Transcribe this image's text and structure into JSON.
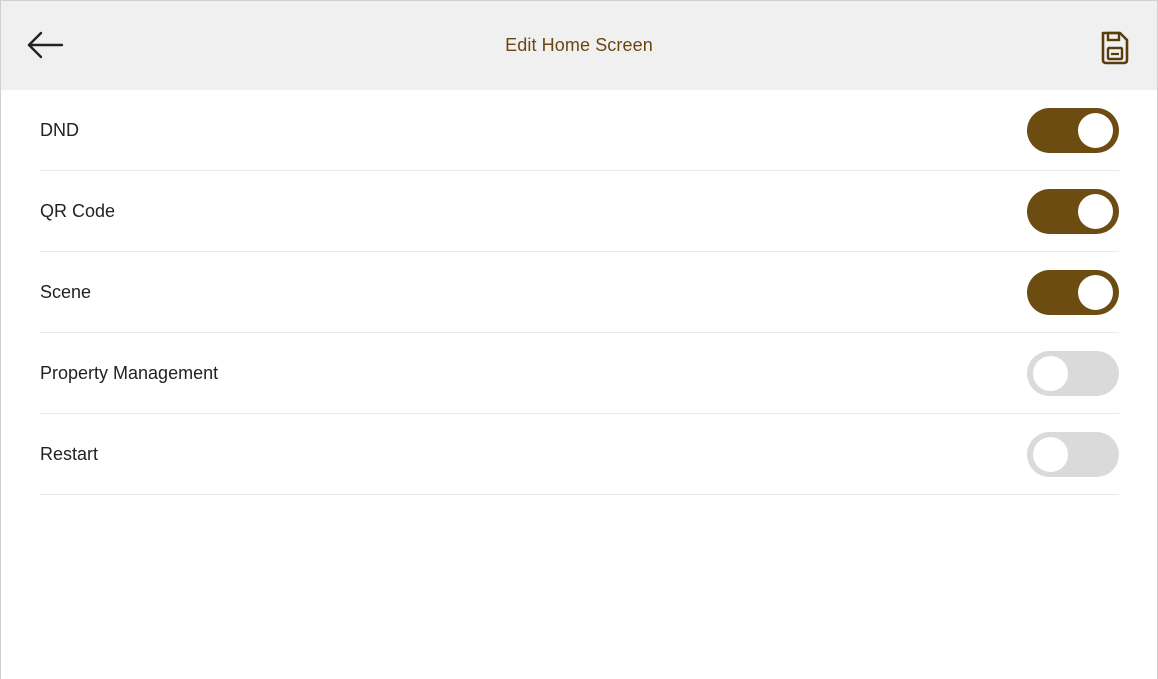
{
  "header": {
    "title": "Edit Home Screen",
    "back_icon": "arrow-left-icon",
    "save_icon": "floppy-disk-icon"
  },
  "colors": {
    "accent": "#6d4c12",
    "title": "#6b4710",
    "toggle_off": "#dadada",
    "header_bg": "#f0f0f0"
  },
  "settings": [
    {
      "label": "DND",
      "enabled": true
    },
    {
      "label": "QR Code",
      "enabled": true
    },
    {
      "label": "Scene",
      "enabled": true
    },
    {
      "label": "Property Management",
      "enabled": false
    },
    {
      "label": "Restart",
      "enabled": false
    }
  ]
}
